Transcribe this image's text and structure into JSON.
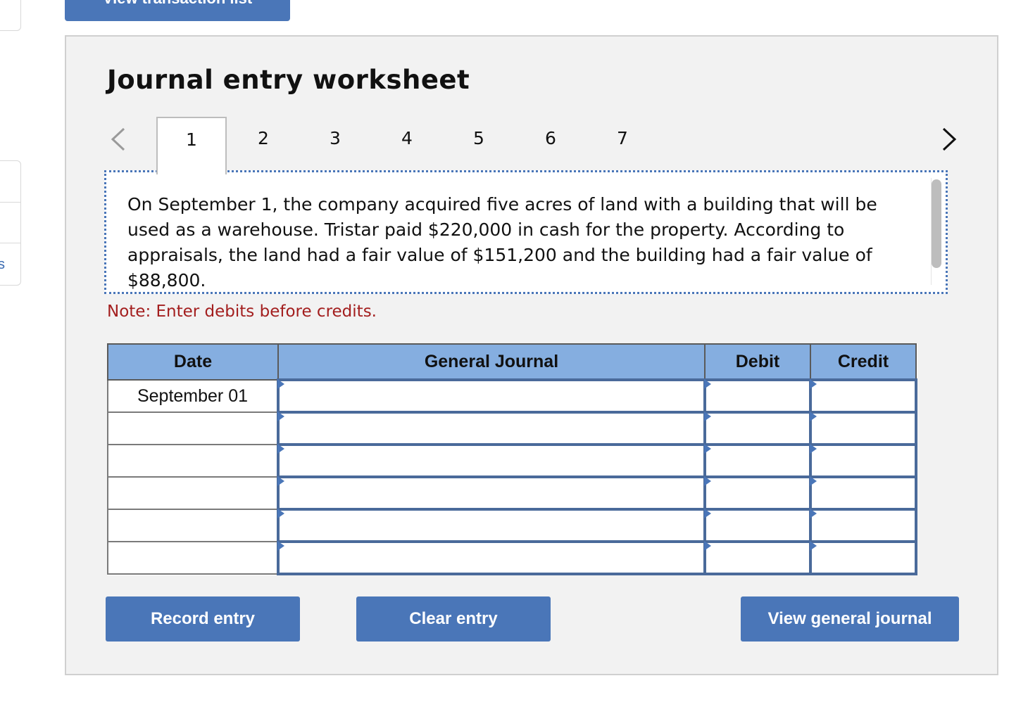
{
  "top_button": {
    "label": "View transaction list"
  },
  "left_tab": {
    "letter": "s"
  },
  "worksheet": {
    "title": "Journal entry worksheet",
    "tabs": [
      {
        "label": "1",
        "active": true
      },
      {
        "label": "2",
        "active": false
      },
      {
        "label": "3",
        "active": false
      },
      {
        "label": "4",
        "active": false
      },
      {
        "label": "5",
        "active": false
      },
      {
        "label": "6",
        "active": false
      },
      {
        "label": "7",
        "active": false
      }
    ],
    "question_text": "On September 1, the company acquired five acres of land with a building that will be used as a warehouse. Tristar paid $220,000 in cash for the property. According to appraisals, the land had a fair value of $151,200 and the building had a fair value of $88,800.",
    "note": "Note: Enter debits before credits.",
    "table": {
      "headers": {
        "date": "Date",
        "journal": "General Journal",
        "debit": "Debit",
        "credit": "Credit"
      },
      "rows": [
        {
          "date": "September 01",
          "journal": "",
          "debit": "",
          "credit": ""
        },
        {
          "date": "",
          "journal": "",
          "debit": "",
          "credit": ""
        },
        {
          "date": "",
          "journal": "",
          "debit": "",
          "credit": ""
        },
        {
          "date": "",
          "journal": "",
          "debit": "",
          "credit": ""
        },
        {
          "date": "",
          "journal": "",
          "debit": "",
          "credit": ""
        },
        {
          "date": "",
          "journal": "",
          "debit": "",
          "credit": ""
        }
      ]
    }
  },
  "buttons": {
    "record": "Record entry",
    "clear": "Clear entry",
    "view_journal": "View general journal"
  },
  "colors": {
    "accent": "#4a76b8",
    "header_blue": "#85aee0",
    "note_red": "#a31e1e",
    "panel_bg": "#f2f2f2"
  }
}
